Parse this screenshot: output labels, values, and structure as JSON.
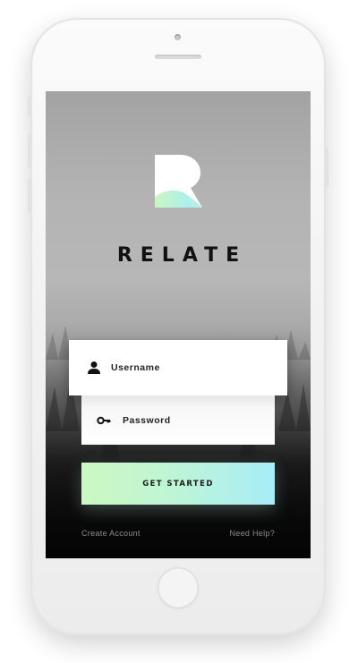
{
  "app": {
    "brand_name": "RELATE",
    "logo_icon": "relate-r-logo",
    "accent_gradient": [
      "#ccf8c2",
      "#a7edf8"
    ]
  },
  "login_form": {
    "username": {
      "placeholder": "Username",
      "icon": "user-icon"
    },
    "password": {
      "placeholder": "Password",
      "icon": "key-icon"
    },
    "submit_label": "GET STARTED"
  },
  "footer": {
    "create_account": "Create Account",
    "need_help": "Need Help?"
  }
}
